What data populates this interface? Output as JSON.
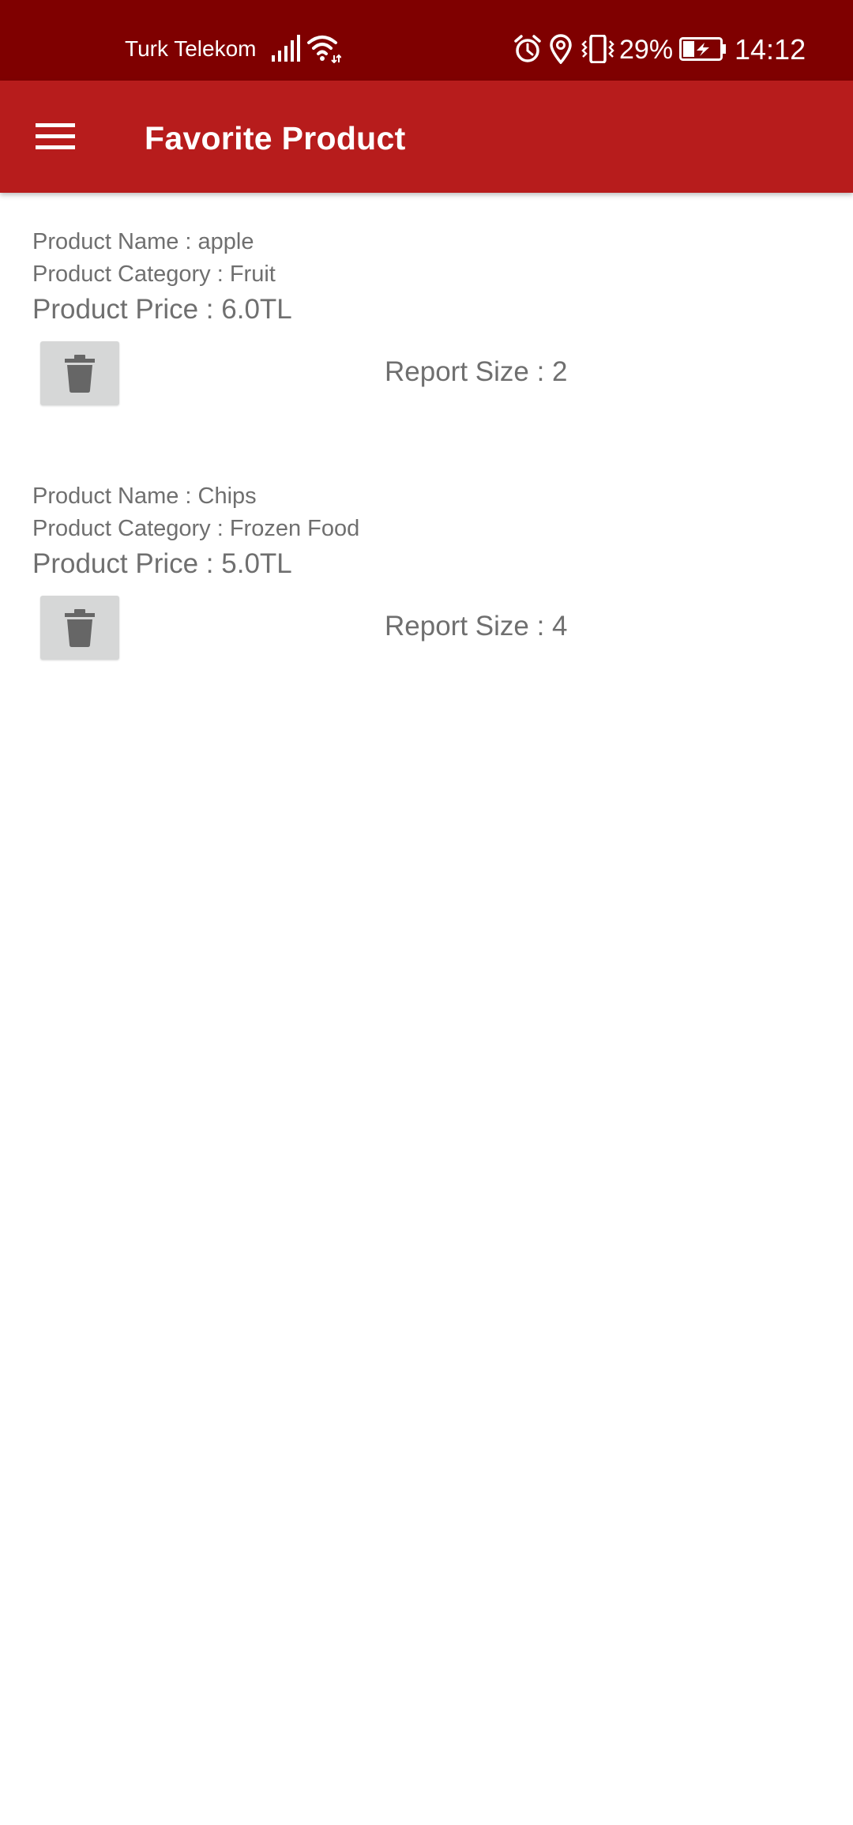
{
  "status_bar": {
    "carrier": "Turk Telekom",
    "battery_percent": "29%",
    "time": "14:12",
    "icons": [
      "signal-icon",
      "wifi-icon",
      "alarm-icon",
      "location-icon",
      "vibrate-icon",
      "battery-charging-icon"
    ]
  },
  "app_bar": {
    "title": "Favorite Product",
    "menu_icon": "hamburger-menu-icon",
    "background_color": "#b71c1c",
    "status_bar_color": "#7f0000"
  },
  "products": [
    {
      "name_text": "Product Name : apple",
      "category_text": "Product Category : Fruit",
      "price_text": "Product Price : 6.0TL",
      "report_text": "Report Size : 2",
      "delete_icon": "trash-icon"
    },
    {
      "name_text": "Product Name : Chips",
      "category_text": "Product Category : Frozen Food",
      "price_text": "Product Price : 5.0TL",
      "report_text": "Report Size : 4",
      "delete_icon": "trash-icon"
    }
  ]
}
